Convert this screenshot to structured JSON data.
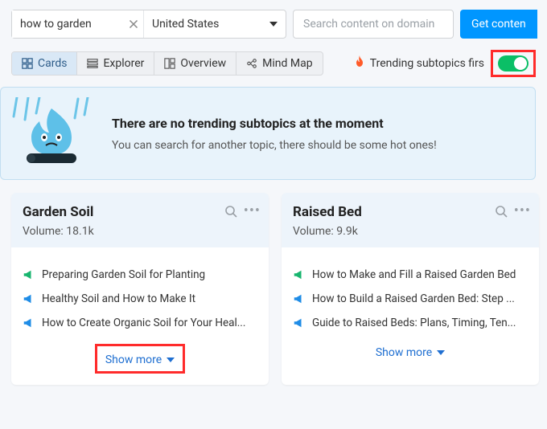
{
  "search": {
    "topic_value": "how to garden",
    "country_value": "United States",
    "domain_placeholder": "Search content on domain",
    "button_label": "Get conten"
  },
  "tabs": {
    "cards": "Cards",
    "explorer": "Explorer",
    "overview": "Overview",
    "mindmap": "Mind Map"
  },
  "trending": {
    "label": "Trending subtopics firs",
    "toggle_on": true
  },
  "empty": {
    "title": "There are no trending subtopics at the moment",
    "subtitle": "You can search for another topic, there should be some hot ones!"
  },
  "cards": [
    {
      "title": "Garden Soil",
      "volume_label": "Volume:",
      "volume_value": "18.1k",
      "items": [
        {
          "color": "g",
          "text": "Preparing Garden Soil for Planting"
        },
        {
          "color": "b",
          "text": "Healthy Soil and How to Make It"
        },
        {
          "color": "b",
          "text": "How to Create Organic Soil for Your Heal..."
        }
      ],
      "show_more": "Show more",
      "highlight_show_more": true
    },
    {
      "title": "Raised Bed",
      "volume_label": "Volume:",
      "volume_value": "9.9k",
      "items": [
        {
          "color": "g",
          "text": "How to Make and Fill a Raised Garden Bed"
        },
        {
          "color": "b",
          "text": "How to Build a Raised Garden Bed: Step ..."
        },
        {
          "color": "b",
          "text": "Guide to Raised Beds: Plans, Timing, Ten..."
        }
      ],
      "show_more": "Show more",
      "highlight_show_more": false
    }
  ]
}
